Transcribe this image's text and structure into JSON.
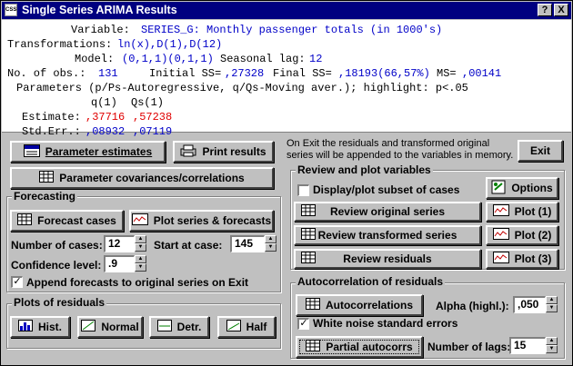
{
  "window": {
    "title": "Single Series ARIMA Results",
    "help_glyph": "?",
    "close_glyph": "X",
    "app_icon_text": "CSS"
  },
  "results": {
    "variable_label": "Variable:",
    "variable_value": "SERIES_G: Monthly passenger totals (in 1000's)",
    "transformations_label": "Transformations:",
    "transformations_value": "ln(x),D(1),D(12)",
    "model_label": "Model:",
    "model_value": "(0,1,1)(0,1,1)",
    "seasonal_lag_label": "Seasonal lag:",
    "seasonal_lag_value": "12",
    "obs_label": "No. of obs.:",
    "obs_value": "131",
    "initial_ss_label": "Initial SS=",
    "initial_ss_value": ",27328",
    "final_ss_label": "Final SS=",
    "final_ss_value": ",18193(66,57%)",
    "ms_label": "MS=",
    "ms_value": ",00141",
    "params_line": "Parameters (p/Ps-Autoregressive, q/Qs-Moving aver.); highlight: p<.05",
    "col_q1": "q(1)",
    "col_qs1": "Qs(1)",
    "estimate_label": "Estimate:",
    "estimate_q1": ",37716",
    "estimate_qs1": ",57238",
    "stderr_label": "Std.Err.:",
    "stderr_q1": ",08932",
    "stderr_qs1": ",07119"
  },
  "buttons": {
    "parameter_estimates": "Parameter estimates",
    "print_results": "Print results",
    "exit": "Exit",
    "param_cov": "Parameter covariances/correlations",
    "forecast_cases": "Forecast cases",
    "plot_series_forecasts": "Plot series & forecasts",
    "options": "Options",
    "review_original": "Review original series",
    "review_transformed": "Review transformed series",
    "review_residuals": "Review residuals",
    "plot1": "Plot (1)",
    "plot2": "Plot (2)",
    "plot3": "Plot (3)",
    "hist": "Hist.",
    "normal": "Normal",
    "detr": "Detr.",
    "half": "Half",
    "autocorrelations": "Autocorrelations",
    "partial_autocorrs": "Partial autocorrs"
  },
  "exit_note": "On Exit the residuals and transformed original series will be appended to the variables in memory.",
  "forecasting": {
    "title": "Forecasting",
    "num_cases_label": "Number of cases:",
    "num_cases_value": "12",
    "start_case_label": "Start at case:",
    "start_case_value": "145",
    "confidence_label": "Confidence level:",
    "confidence_value": ".9",
    "append_label": "Append forecasts to original series on Exit",
    "append_checked": true
  },
  "review": {
    "title": "Review and plot variables",
    "display_subset_label": "Display/plot subset of cases",
    "display_subset_checked": false
  },
  "plots_residuals": {
    "title": "Plots of residuals"
  },
  "autocorr": {
    "title": "Autocorrelation of residuals",
    "alpha_label": "Alpha (highl.):",
    "alpha_value": ",050",
    "white_noise_label": "White noise standard errors",
    "white_noise_checked": true,
    "lags_label": "Number of lags:",
    "lags_value": "15"
  }
}
